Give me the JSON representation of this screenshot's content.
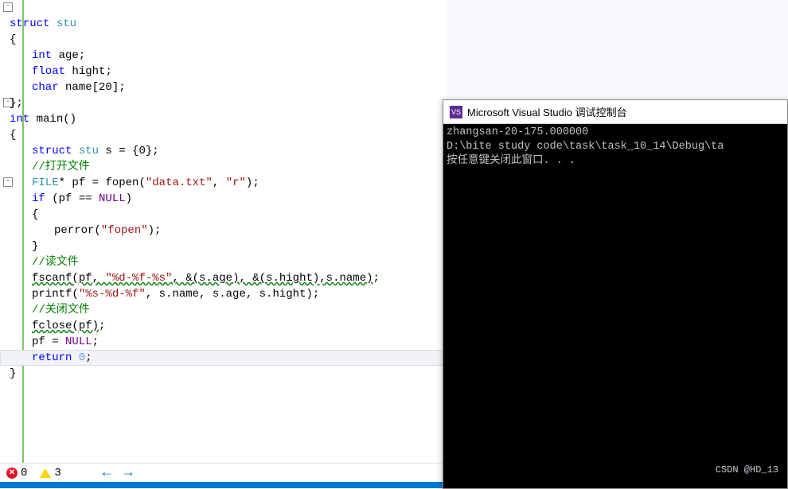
{
  "editor": {
    "struct_kw": "struct",
    "struct_name": " stu",
    "brace_open": "{",
    "brace_close": "}",
    "semicolon": ";",
    "int_kw": "int",
    "float_kw": "float",
    "char_kw": "char",
    "field_age": " age",
    "field_hight": " hight",
    "field_name": " name[20]",
    "main_sig": " main()",
    "decl_s": " s = ",
    "init_braces": "{0}",
    "comment_open": "//打开文件",
    "file_type": "FILE",
    "star": "*",
    "pf_var": " pf = ",
    "fopen_fn": "fopen",
    "open_paren": "(",
    "close_paren": ")",
    "str_data": "\"data.txt\"",
    "comma_space": ", ",
    "str_mode": "\"r\"",
    "if_kw": "if",
    "cond_null": " (pf == ",
    "null_macro": "NULL",
    "perror_fn": "perror",
    "str_fopen": "\"fopen\"",
    "comment_read": "//读文件",
    "fscanf_fn": "fscanf",
    "fscanf_first_arg": "(pf, ",
    "fscanf_fmt": "\"%d-%f-%s\"",
    "fscanf_args": ", &(s.age), &(s.hight),s.name)",
    "printf_fn": "printf",
    "printf_fmt": "\"%s-%d-%f\"",
    "printf_args": ", s.name, s.age, s.hight)",
    "comment_close": "//关闭文件",
    "fclose_fn": "fclose",
    "fclose_arg": "(pf)",
    "pf_assign": "pf = ",
    "return_kw": "return",
    "zero": " 0"
  },
  "status": {
    "errors": "0",
    "warnings": "3"
  },
  "console": {
    "title": "Microsoft Visual Studio 调试控制台",
    "line1": "zhangsan-20-175.000000",
    "line2": "D:\\bite study code\\task\\task_10_14\\Debug\\ta",
    "line3": "按任意键关闭此窗口. . ."
  },
  "watermark": "CSDN @HD_13"
}
